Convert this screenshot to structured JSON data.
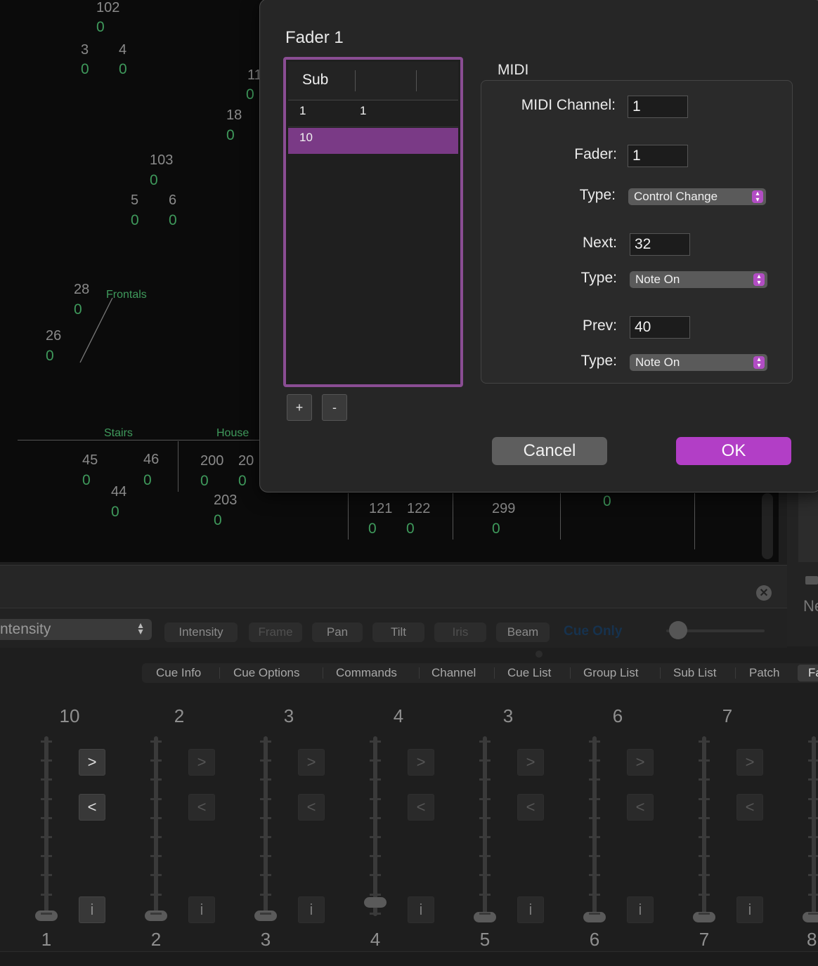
{
  "stage": {
    "numbers": [
      {
        "n": "102",
        "v": "0"
      },
      {
        "n": "3",
        "v": "0"
      },
      {
        "n": "4",
        "v": "0"
      },
      {
        "n": "11",
        "v": "0"
      },
      {
        "n": "18",
        "v": "0"
      },
      {
        "n": "103",
        "v": "0"
      },
      {
        "n": "5",
        "v": "0"
      },
      {
        "n": "6",
        "v": "0"
      },
      {
        "n": "28",
        "v": "0"
      },
      {
        "n": "26",
        "v": "0"
      },
      {
        "n": "45",
        "v": "0"
      },
      {
        "n": "46",
        "v": "0"
      },
      {
        "n": "44",
        "v": "0"
      },
      {
        "n": "200",
        "v": "0"
      },
      {
        "n": "20",
        "v": "0"
      },
      {
        "n": "203",
        "v": "0"
      },
      {
        "n": "121",
        "v": "0"
      },
      {
        "n": "122",
        "v": "0"
      },
      {
        "n": "299",
        "v": "0"
      }
    ],
    "extra_value": "0",
    "labels": {
      "frontals": "Frontals",
      "stairs": "Stairs",
      "house": "House"
    }
  },
  "right_strip": {
    "text": "Ne"
  },
  "attribute_bar": {
    "select_value": "ntensity",
    "buttons": [
      "Intensity",
      "Frame",
      "Pan",
      "Tilt",
      "Iris",
      "Beam"
    ],
    "cue_only": "Cue Only"
  },
  "tabs": [
    "Cue Info",
    "Cue Options",
    "Commands",
    "Channel",
    "Cue List",
    "Group List",
    "Sub List",
    "Patch",
    "Fa"
  ],
  "faders": {
    "top_labels": [
      "10",
      "2",
      "3",
      "4",
      "3",
      "6",
      "7"
    ],
    "bottom_labels": [
      "1",
      "2",
      "3",
      "4",
      "5",
      "6",
      "7",
      "8"
    ],
    "next_glyph": ">",
    "prev_glyph": "<",
    "info_glyph": "i"
  },
  "dialog": {
    "title": "Fader 1",
    "table": {
      "headers": [
        "Sub",
        "",
        ""
      ],
      "rows": [
        [
          "1",
          "1"
        ],
        [
          "10",
          ""
        ]
      ],
      "selected_row": 1
    },
    "add_label": "+",
    "remove_label": "-",
    "midi_section": "MIDI",
    "fields": {
      "channel_label": "MIDI Channel:",
      "channel_value": "1",
      "fader_label": "Fader:",
      "fader_value": "1",
      "type_label": "Type:",
      "fader_type": "Control Change",
      "next_label": "Next:",
      "next_value": "32",
      "next_type": "Note On",
      "prev_label": "Prev:",
      "prev_value": "40",
      "prev_type": "Note On"
    },
    "cancel_label": "Cancel",
    "ok_label": "OK"
  },
  "colors": {
    "accent": "#b24dc4",
    "selection": "#7a3a86",
    "stage_value": "#3f9a5c"
  }
}
